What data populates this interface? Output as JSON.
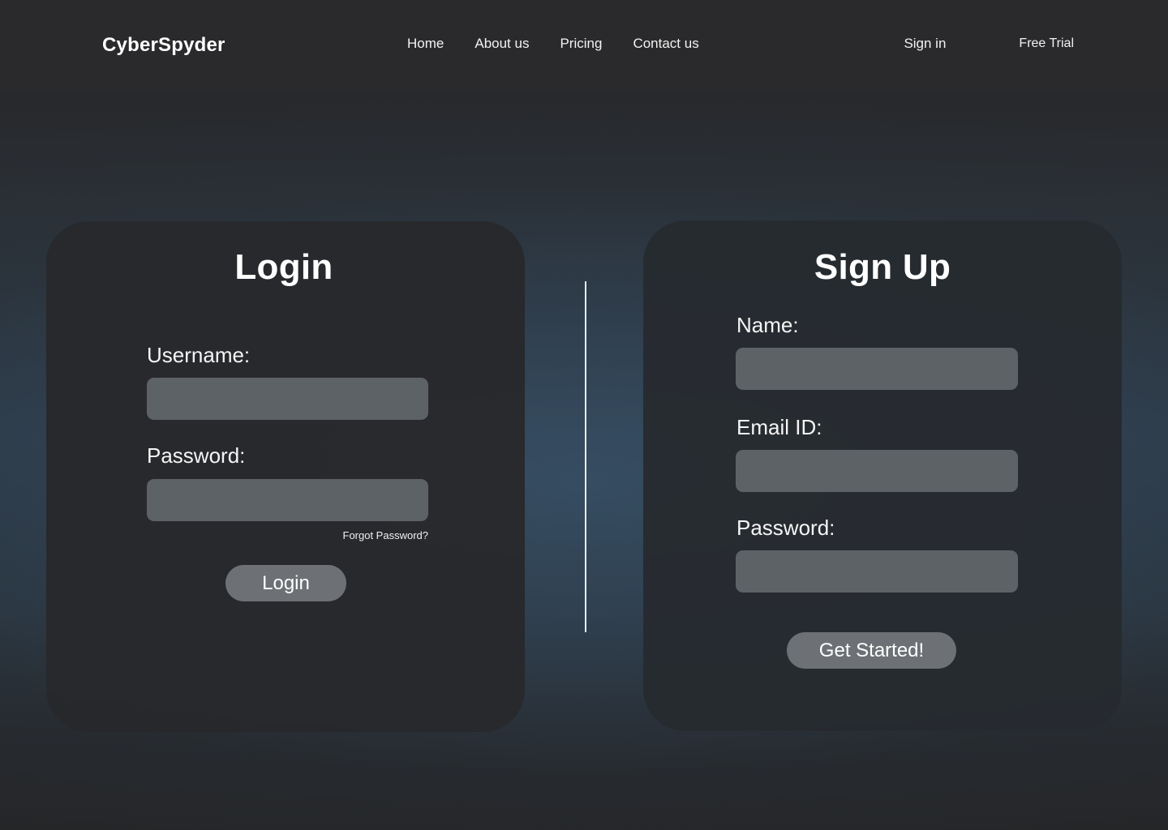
{
  "header": {
    "logo": "CyberSpyder",
    "nav_links": [
      {
        "label": "Home"
      },
      {
        "label": "About us"
      },
      {
        "label": "Pricing"
      },
      {
        "label": "Contact us"
      }
    ],
    "actions": {
      "sign_in": "Sign in",
      "free_trial": "Free Trial"
    }
  },
  "login_card": {
    "title": "Login",
    "username": {
      "label": "Username:",
      "value": "",
      "placeholder": ""
    },
    "password": {
      "label": "Password:",
      "value": "",
      "placeholder": ""
    },
    "forgot_password": "Forgot Password?",
    "submit_label": "Login"
  },
  "signup_card": {
    "title": "Sign Up",
    "name": {
      "label": "Name:",
      "value": "",
      "placeholder": ""
    },
    "email": {
      "label": "Email ID:",
      "value": "",
      "placeholder": ""
    },
    "password": {
      "label": "Password:",
      "value": "",
      "placeholder": ""
    },
    "submit_label": "Get Started!"
  },
  "colors": {
    "page_top": "#262729",
    "page_center": "#2e3b48",
    "header_bg": "#2a2a2c",
    "card_bg": "#282a2c",
    "input_bg": "#5d6267",
    "button_bg": "#6d7175",
    "divider": "#e8eaec",
    "text": "#ffffff"
  }
}
